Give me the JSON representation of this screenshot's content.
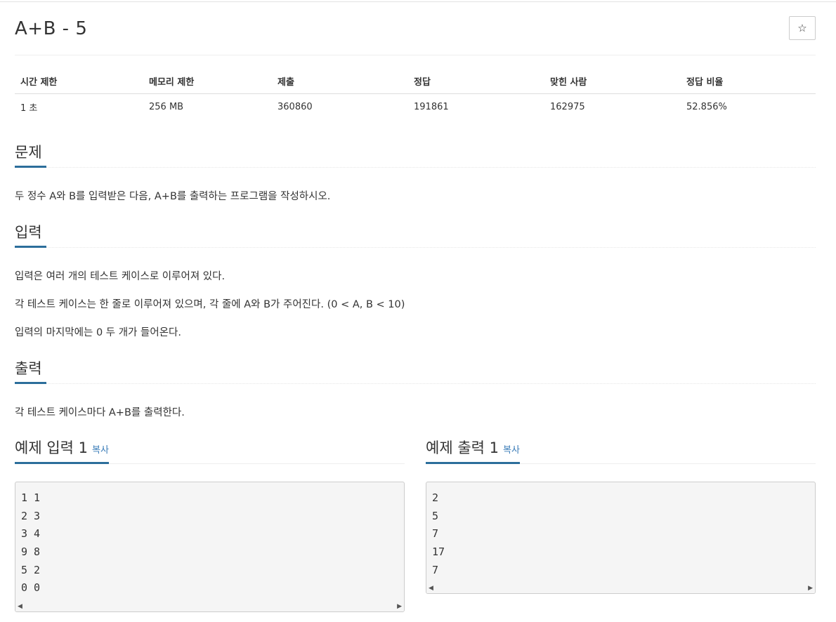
{
  "problem": {
    "title": "A+B - 5",
    "star_icon": "☆"
  },
  "info_table": {
    "headers": [
      "시간 제한",
      "메모리 제한",
      "제출",
      "정답",
      "맞힌 사람",
      "정답 비율"
    ],
    "values": [
      "1 초",
      "256 MB",
      "360860",
      "191861",
      "162975",
      "52.856%"
    ]
  },
  "sections": {
    "description": {
      "heading": "문제",
      "paragraphs": [
        "두 정수 A와 B를 입력받은 다음, A+B를 출력하는 프로그램을 작성하시오."
      ]
    },
    "input": {
      "heading": "입력",
      "paragraphs": [
        "입력은 여러 개의 테스트 케이스로 이루어져 있다.",
        "각 테스트 케이스는 한 줄로 이루어져 있으며, 각 줄에 A와 B가 주어진다. (0 < A, B < 10)",
        "입력의 마지막에는 0 두 개가 들어온다."
      ]
    },
    "output": {
      "heading": "출력",
      "paragraphs": [
        "각 테스트 케이스마다 A+B를 출력한다."
      ]
    }
  },
  "samples": {
    "input": {
      "heading": "예제 입력 1",
      "copy_label": "복사",
      "lines": [
        "1 1",
        "2 3",
        "3 4",
        "9 8",
        "5 2",
        "0 0"
      ]
    },
    "output": {
      "heading": "예제 출력 1",
      "copy_label": "복사",
      "lines": [
        "2",
        "5",
        "7",
        "17",
        "7"
      ]
    }
  },
  "colors": {
    "accent": "#2c6e9b",
    "link": "#3a7cb8",
    "pre_background": "#f5f5f5"
  }
}
